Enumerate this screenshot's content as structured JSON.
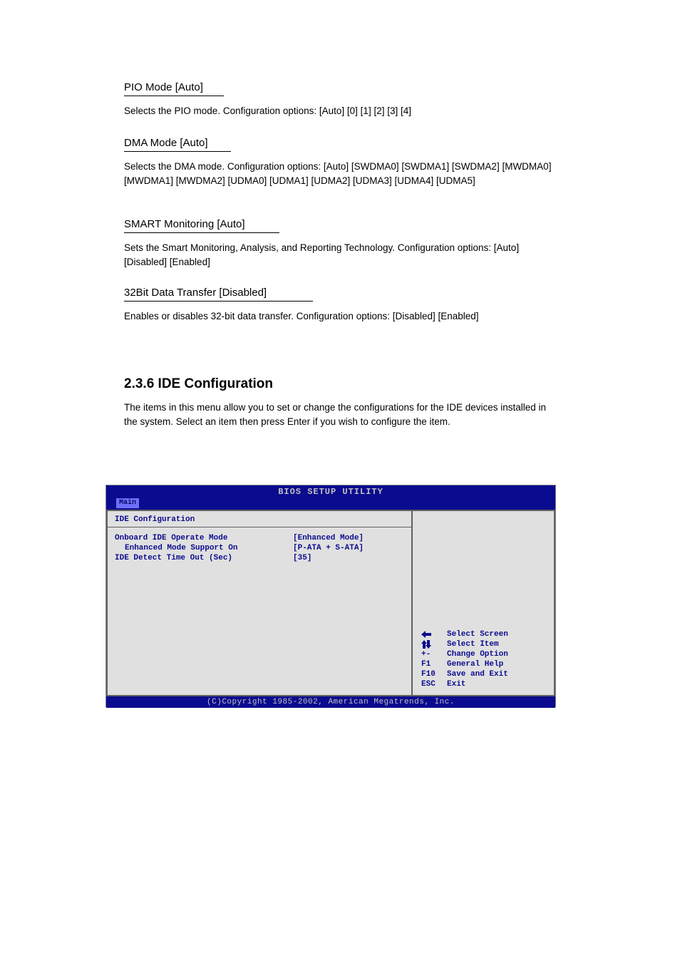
{
  "sections": {
    "pio_mode": {
      "heading": "PIO Mode [Auto]",
      "body": "Selects the PIO mode. Configuration options: [Auto] [0] [1] [2] [3] [4]"
    },
    "dma_mode": {
      "heading": "DMA Mode [Auto]",
      "body": "Selects the DMA mode. Configuration options: [Auto] [SWDMA0] [SWDMA1] [SWDMA2] [MWDMA0] [MWDMA1] [MWDMA2] [UDMA0] [UDMA1] [UDMA2] [UDMA3] [UDMA4] [UDMA5]"
    },
    "smart": {
      "heading": "SMART Monitoring [Auto]",
      "body": "Sets the Smart Monitoring, Analysis, and Reporting Technology. Configuration options: [Auto] [Disabled] [Enabled]"
    },
    "xfer32": {
      "heading": "32Bit Data Transfer [Disabled]",
      "body": "Enables or disables 32-bit data transfer. Configuration options: [Disabled] [Enabled]"
    },
    "ide_config": {
      "heading": "2.3.6  IDE Configuration",
      "body": "The items in this menu allow you to set or change the configurations for the IDE devices installed in the system. Select an item then press Enter if you wish to configure the item."
    }
  },
  "bios": {
    "title": "BIOS SETUP UTILITY",
    "tab": "Main",
    "section_title": "IDE Configuration",
    "options": [
      {
        "label": "Onboard IDE Operate Mode",
        "value": "[Enhanced Mode]",
        "indent": false
      },
      {
        "label": "Enhanced Mode Support On",
        "value": "[P-ATA + S-ATA]",
        "indent": true
      },
      {
        "label": "IDE Detect Time Out (Sec)",
        "value": "[35]",
        "indent": false
      }
    ],
    "help": [
      {
        "key_icon": "arrow-left",
        "key": "",
        "text": "Select Screen"
      },
      {
        "key_icon": "arrows-updown",
        "key": "",
        "text": "Select Item"
      },
      {
        "key_icon": "",
        "key": "+-",
        "text": "Change Option"
      },
      {
        "key_icon": "",
        "key": "F1",
        "text": "General Help"
      },
      {
        "key_icon": "",
        "key": "F10",
        "text": "Save and Exit"
      },
      {
        "key_icon": "",
        "key": "ESC",
        "text": "Exit"
      }
    ],
    "footer": "(C)Copyright 1985-2002, American Megatrends, Inc."
  }
}
